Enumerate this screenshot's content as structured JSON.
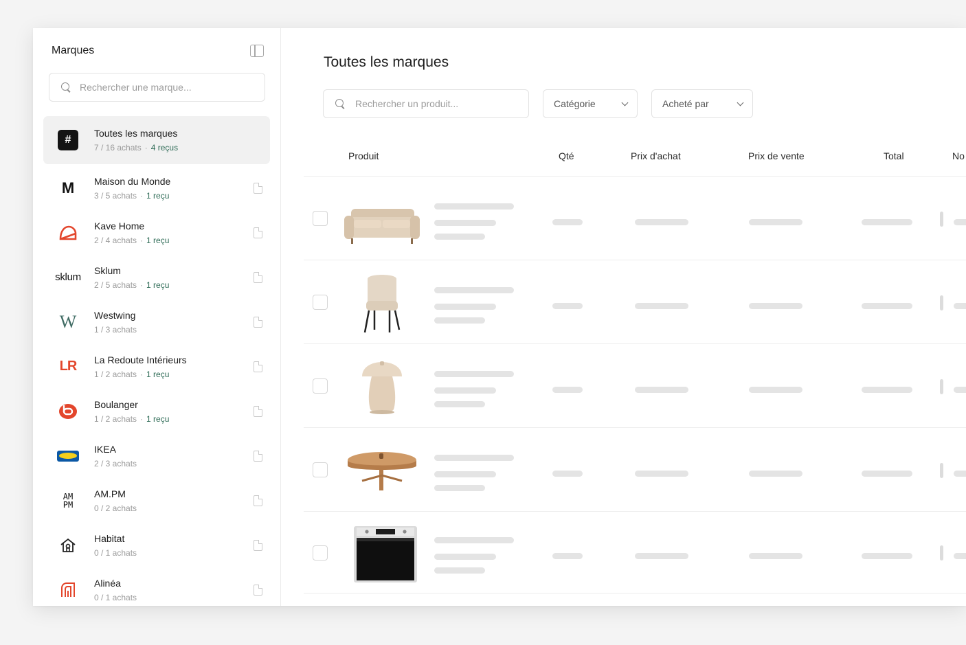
{
  "sidebar": {
    "title": "Marques",
    "search_placeholder": "Rechercher une marque...",
    "brands": [
      {
        "name": "Toutes les marques",
        "count": "7 / 16 achats",
        "received": "4 reçus",
        "logo": "#"
      },
      {
        "name": "Maison du Monde",
        "count": "3 / 5 achats",
        "received": "1 reçu",
        "logo": "M"
      },
      {
        "name": "Kave Home",
        "count": "2 / 4 achats",
        "received": "1 reçu",
        "logo": "kave-home-logo"
      },
      {
        "name": "Sklum",
        "count": "2 / 5 achats",
        "received": "1 reçu",
        "logo": "sklum"
      },
      {
        "name": "Westwing",
        "count": "1 / 3 achats",
        "received": "",
        "logo": "W"
      },
      {
        "name": "La Redoute Intérieurs",
        "count": "1 / 2 achats",
        "received": "1 reçu",
        "logo": "LR"
      },
      {
        "name": "Boulanger",
        "count": "1 / 2 achats",
        "received": "1 reçu",
        "logo": "boulanger-logo"
      },
      {
        "name": "IKEA",
        "count": "2 / 3 achats",
        "received": "",
        "logo": "ikea-logo"
      },
      {
        "name": "AM.PM",
        "count": "0 / 2 achats",
        "received": "",
        "logo": "AM PM"
      },
      {
        "name": "Habitat",
        "count": "0 / 1 achats",
        "received": "",
        "logo": "habitat-logo"
      },
      {
        "name": "Alinéa",
        "count": "0 / 1 achats",
        "received": "",
        "logo": "alinea-logo"
      }
    ],
    "colors": {
      "received_text": "#2e6b56",
      "meta_text": "#9a9a9a",
      "active_bg": "#f1f1f1"
    }
  },
  "main": {
    "title": "Toutes les marques",
    "search_placeholder": "Rechercher un produit...",
    "filter_category": "Catégorie",
    "filter_buyer": "Acheté par",
    "columns": [
      "Produit",
      "Qté",
      "Prix d'achat",
      "Prix de vente",
      "Total",
      "No"
    ],
    "rows": [
      {
        "product": "sofa"
      },
      {
        "product": "armchair"
      },
      {
        "product": "mushroom-lamp"
      },
      {
        "product": "coffee-table"
      },
      {
        "product": "oven"
      }
    ]
  }
}
